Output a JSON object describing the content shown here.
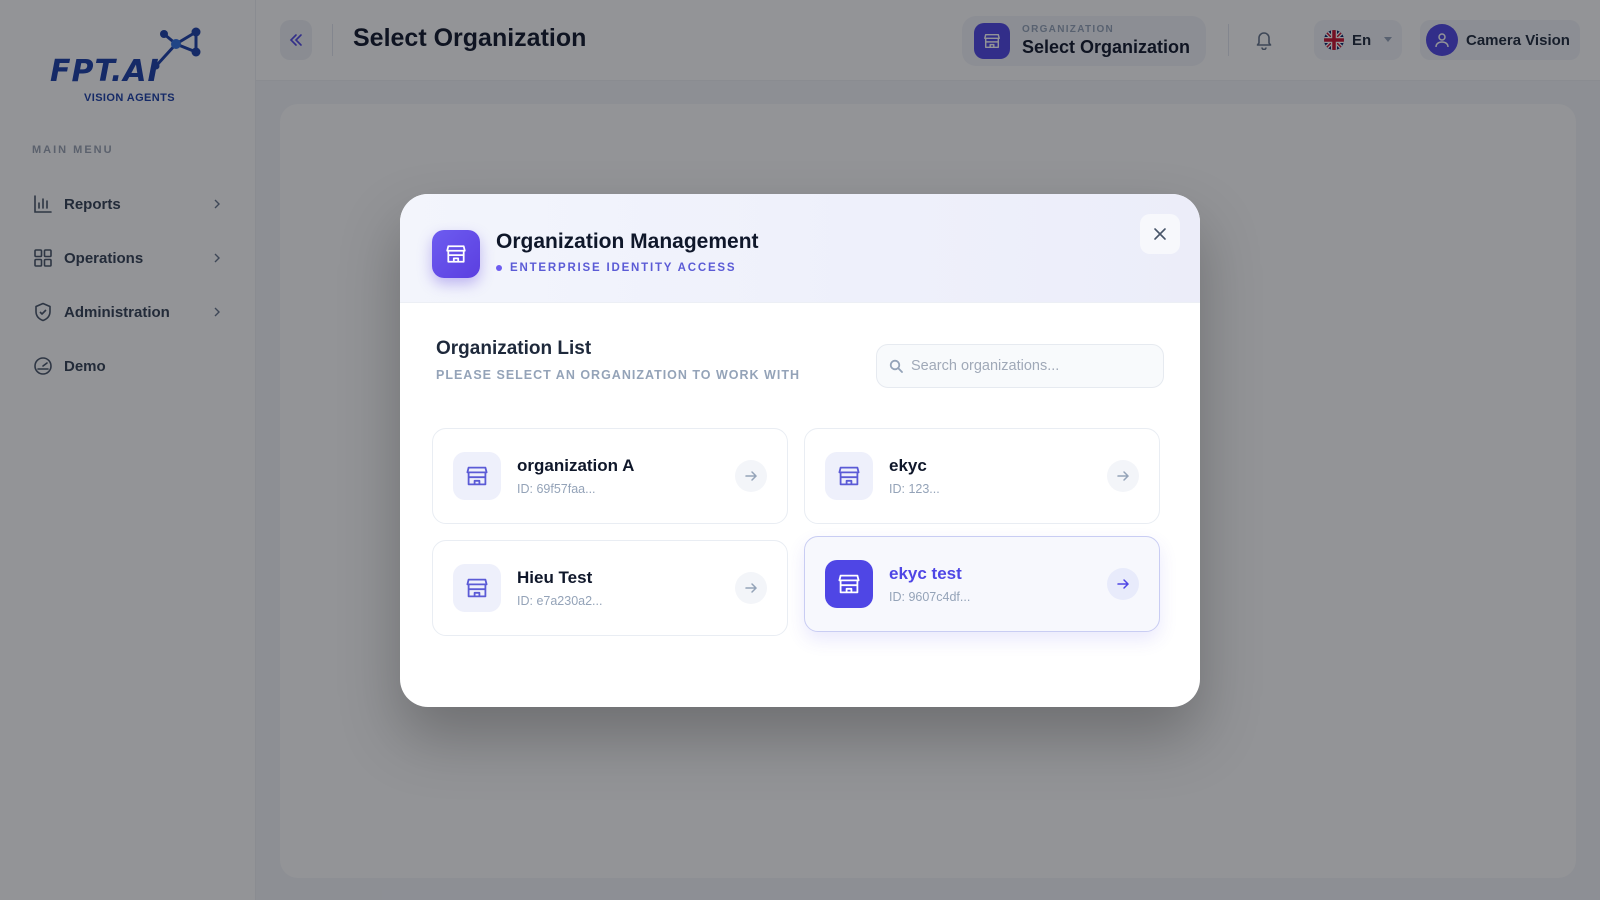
{
  "brand": {
    "logo_text": "FPT.AI",
    "logo_subtitle": "VISION AGENTS",
    "accent_color": "#4f46e5",
    "logo_color": "#1b3fa8"
  },
  "sidebar": {
    "heading": "MAIN MENU",
    "items": [
      {
        "label": "Reports",
        "icon": "bar-chart-icon",
        "has_submenu": true
      },
      {
        "label": "Operations",
        "icon": "grid-icon",
        "has_submenu": true
      },
      {
        "label": "Administration",
        "icon": "shield-icon",
        "has_submenu": true
      },
      {
        "label": "Demo",
        "icon": "gauge-icon",
        "has_submenu": false
      }
    ]
  },
  "header": {
    "title": "Select Organization",
    "org_caption": "ORGANIZATION",
    "org_value": "Select Organization",
    "language": "En",
    "user_name": "Camera Vision"
  },
  "modal": {
    "title": "Organization Management",
    "subtitle": "ENTERPRISE IDENTITY ACCESS",
    "list_title": "Organization List",
    "list_subtitle": "PLEASE SELECT AN ORGANIZATION TO WORK WITH",
    "search_placeholder": "Search organizations...",
    "organizations": [
      {
        "name": "organization A",
        "id": "ID: 69f57faa...",
        "selected": false
      },
      {
        "name": "ekyc",
        "id": "ID: 123...",
        "selected": false
      },
      {
        "name": "Hieu Test",
        "id": "ID: e7a230a2...",
        "selected": false
      },
      {
        "name": "ekyc test",
        "id": "ID: 9607c4df...",
        "selected": true
      }
    ]
  }
}
